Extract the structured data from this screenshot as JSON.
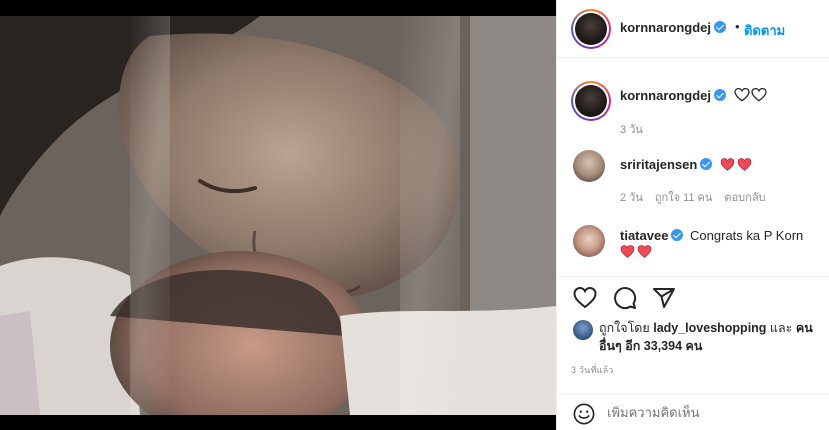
{
  "colors": {
    "accent": "#0095f6",
    "verified": "#3897f0",
    "heart_red": "#ed4956",
    "muted_text": "#8e8e8e",
    "text": "#262626"
  },
  "post": {
    "image_alt": "photo"
  },
  "header": {
    "username": "kornnarongdej",
    "separator": "•",
    "follow_label": "ติดตาม"
  },
  "caption": {
    "username": "kornnarongdej",
    "icons": [
      "heart-outline-icon",
      "heart-outline-icon"
    ],
    "time": "3 วัน"
  },
  "comments": [
    {
      "username": "sriritajensen",
      "icons": [
        "heart-red-icon",
        "heart-red-icon"
      ],
      "time": "2 วัน",
      "likes": "ถูกใจ 11 คน",
      "reply_label": "ตอบกลับ"
    },
    {
      "username": "tiatavee",
      "text": "Congrats ka P Korn",
      "icons": [
        "heart-red-icon",
        "heart-red-icon"
      ]
    }
  ],
  "actions": {
    "icons": [
      "heart-outline-icon",
      "comment-icon",
      "share-icon"
    ]
  },
  "likes": {
    "prefix": "ถูกใจโดย",
    "liker": "lady_loveshopping",
    "joiner": "และ",
    "others": "คนอื่นๆ อีก 33,394 คน"
  },
  "posted_ago": "3 วันที่แล้ว",
  "comment_box": {
    "placeholder": "เพิ่มความคิดเห็น",
    "emoji_icon": "emoji-icon"
  }
}
